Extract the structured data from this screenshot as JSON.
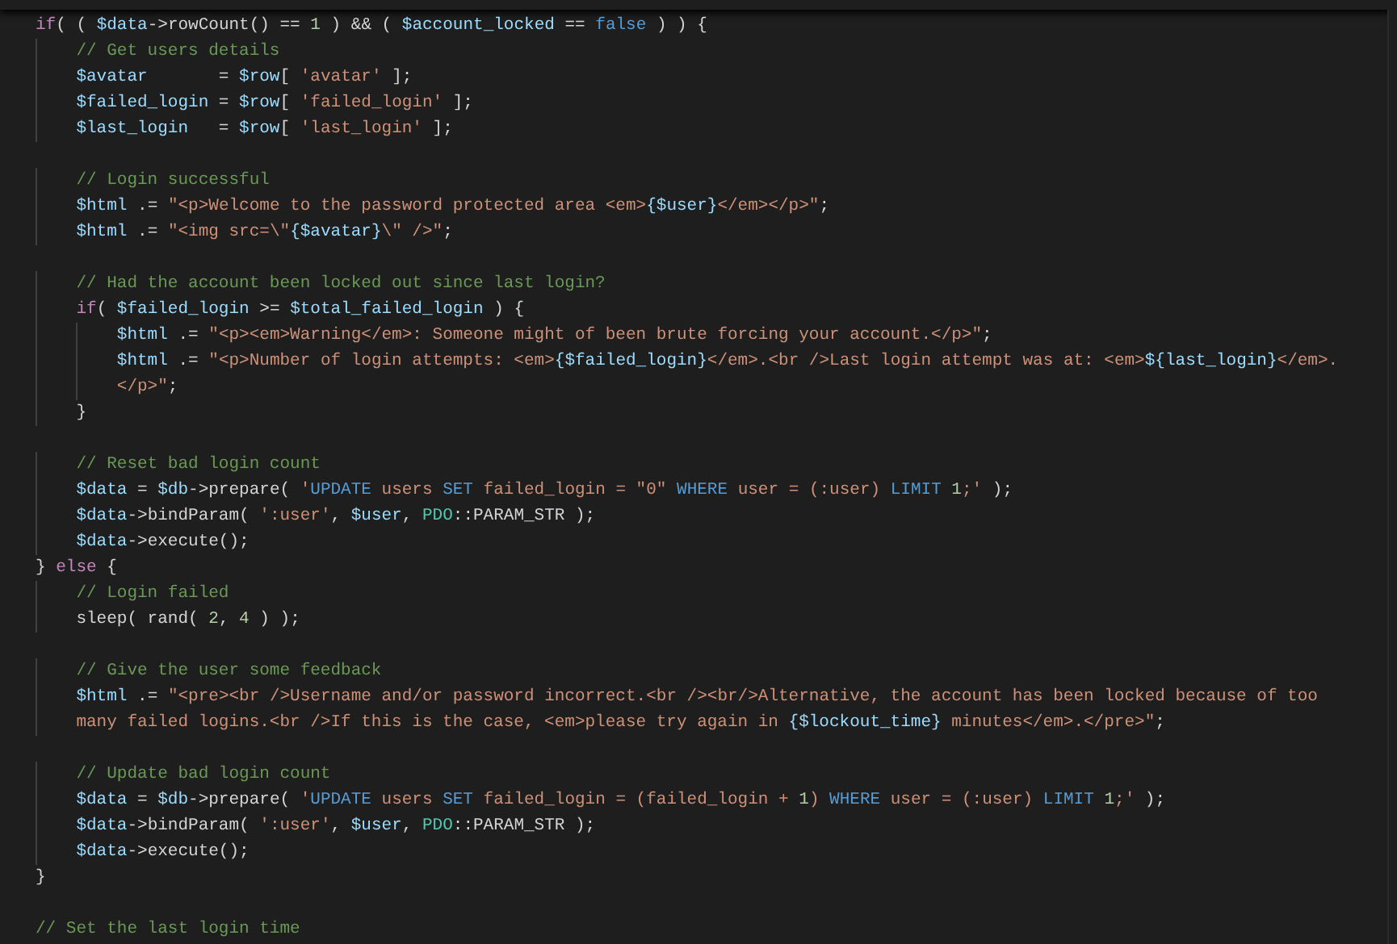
{
  "editor": {
    "lines": [
      {
        "kind": "code",
        "tokens": [
          {
            "kind": "keyword",
            "text": "if"
          },
          {
            "kind": "plain",
            "text": "( ( "
          },
          {
            "kind": "variable",
            "text": "$data"
          },
          {
            "kind": "plain",
            "text": "->rowCount() == "
          },
          {
            "kind": "number",
            "text": "1"
          },
          {
            "kind": "plain",
            "text": " ) && ( "
          },
          {
            "kind": "variable",
            "text": "$account_locked"
          },
          {
            "kind": "plain",
            "text": " == "
          },
          {
            "kind": "constant",
            "text": "false"
          },
          {
            "kind": "plain",
            "text": " ) ) {"
          }
        ]
      },
      {
        "kind": "code",
        "tokens": [
          {
            "kind": "comment",
            "text": "    // Get users details"
          }
        ]
      },
      {
        "kind": "code",
        "tokens": [
          {
            "kind": "variable",
            "text": "    $avatar"
          },
          {
            "kind": "plain",
            "text": "       = "
          },
          {
            "kind": "variable",
            "text": "$row"
          },
          {
            "kind": "plain",
            "text": "[ "
          },
          {
            "kind": "string",
            "text": "'avatar'"
          },
          {
            "kind": "plain",
            "text": " ];"
          }
        ]
      },
      {
        "kind": "code",
        "tokens": [
          {
            "kind": "variable",
            "text": "    $failed_login"
          },
          {
            "kind": "plain",
            "text": " = "
          },
          {
            "kind": "variable",
            "text": "$row"
          },
          {
            "kind": "plain",
            "text": "[ "
          },
          {
            "kind": "string",
            "text": "'failed_login'"
          },
          {
            "kind": "plain",
            "text": " ];"
          }
        ]
      },
      {
        "kind": "code",
        "tokens": [
          {
            "kind": "variable",
            "text": "    $last_login"
          },
          {
            "kind": "plain",
            "text": "   = "
          },
          {
            "kind": "variable",
            "text": "$row"
          },
          {
            "kind": "plain",
            "text": "[ "
          },
          {
            "kind": "string",
            "text": "'last_login'"
          },
          {
            "kind": "plain",
            "text": " ];"
          }
        ]
      },
      {
        "kind": "blank"
      },
      {
        "kind": "code",
        "tokens": [
          {
            "kind": "comment",
            "text": "    // Login successful"
          }
        ]
      },
      {
        "kind": "code",
        "tokens": [
          {
            "kind": "variable",
            "text": "    $html"
          },
          {
            "kind": "plain",
            "text": " .= "
          },
          {
            "kind": "string",
            "text": "\"<p>Welcome to the password protected area <em>"
          },
          {
            "kind": "variable",
            "text": "{$user}"
          },
          {
            "kind": "string",
            "text": "</em></p>\""
          },
          {
            "kind": "plain",
            "text": ";"
          }
        ]
      },
      {
        "kind": "code",
        "tokens": [
          {
            "kind": "variable",
            "text": "    $html"
          },
          {
            "kind": "plain",
            "text": " .= "
          },
          {
            "kind": "string",
            "text": "\"<img src=\\\""
          },
          {
            "kind": "variable",
            "text": "{$avatar}"
          },
          {
            "kind": "string",
            "text": "\\\" />\""
          },
          {
            "kind": "plain",
            "text": ";"
          }
        ]
      },
      {
        "kind": "blank"
      },
      {
        "kind": "code",
        "tokens": [
          {
            "kind": "comment",
            "text": "    // Had the account been locked out since last login?"
          }
        ]
      },
      {
        "kind": "code",
        "tokens": [
          {
            "kind": "keyword",
            "text": "    if"
          },
          {
            "kind": "plain",
            "text": "( "
          },
          {
            "kind": "variable",
            "text": "$failed_login"
          },
          {
            "kind": "plain",
            "text": " >= "
          },
          {
            "kind": "variable",
            "text": "$total_failed_login"
          },
          {
            "kind": "plain",
            "text": " ) {"
          }
        ]
      },
      {
        "kind": "code",
        "tokens": [
          {
            "kind": "variable",
            "text": "        $html"
          },
          {
            "kind": "plain",
            "text": " .= "
          },
          {
            "kind": "string",
            "text": "\"<p><em>Warning</em>: Someone might of been brute forcing your account.</p>\""
          },
          {
            "kind": "plain",
            "text": ";"
          }
        ]
      },
      {
        "kind": "code",
        "tokens": [
          {
            "kind": "variable",
            "text": "        $html"
          },
          {
            "kind": "plain",
            "text": " .= "
          },
          {
            "kind": "string",
            "text": "\"<p>Number of login attempts: <em>"
          },
          {
            "kind": "variable",
            "text": "{$failed_login}"
          },
          {
            "kind": "string",
            "text": "</em>.<br />Last login attempt was at: <em>"
          },
          {
            "kind": "variable",
            "text": "${last_login}"
          },
          {
            "kind": "string",
            "text": "</em>."
          }
        ]
      },
      {
        "kind": "code",
        "tokens": [
          {
            "kind": "string",
            "text": "        </p>\""
          },
          {
            "kind": "plain",
            "text": ";"
          }
        ]
      },
      {
        "kind": "code",
        "tokens": [
          {
            "kind": "plain",
            "text": "    }"
          }
        ]
      },
      {
        "kind": "blank"
      },
      {
        "kind": "code",
        "tokens": [
          {
            "kind": "comment",
            "text": "    // Reset bad login count"
          }
        ]
      },
      {
        "kind": "code",
        "tokens": [
          {
            "kind": "variable",
            "text": "    $data"
          },
          {
            "kind": "plain",
            "text": " = "
          },
          {
            "kind": "variable",
            "text": "$db"
          },
          {
            "kind": "plain",
            "text": "->prepare( "
          },
          {
            "kind": "string",
            "text": "'"
          },
          {
            "kind": "constant",
            "text": "UPDATE"
          },
          {
            "kind": "string",
            "text": " users "
          },
          {
            "kind": "constant",
            "text": "SET"
          },
          {
            "kind": "string",
            "text": " failed_login = \"0\" "
          },
          {
            "kind": "constant",
            "text": "WHERE"
          },
          {
            "kind": "string",
            "text": " user = (:user) "
          },
          {
            "kind": "constant",
            "text": "LIMIT "
          },
          {
            "kind": "number",
            "text": "1"
          },
          {
            "kind": "string",
            "text": ";'"
          },
          {
            "kind": "plain",
            "text": " );"
          }
        ]
      },
      {
        "kind": "code",
        "tokens": [
          {
            "kind": "variable",
            "text": "    $data"
          },
          {
            "kind": "plain",
            "text": "->bindParam( "
          },
          {
            "kind": "string",
            "text": "':user'"
          },
          {
            "kind": "plain",
            "text": ", "
          },
          {
            "kind": "variable",
            "text": "$user"
          },
          {
            "kind": "plain",
            "text": ", "
          },
          {
            "kind": "type",
            "text": "PDO"
          },
          {
            "kind": "plain",
            "text": "::PARAM_STR );"
          }
        ]
      },
      {
        "kind": "code",
        "tokens": [
          {
            "kind": "variable",
            "text": "    $data"
          },
          {
            "kind": "plain",
            "text": "->execute();"
          }
        ]
      },
      {
        "kind": "code",
        "tokens": [
          {
            "kind": "plain",
            "text": "} "
          },
          {
            "kind": "keyword",
            "text": "else"
          },
          {
            "kind": "plain",
            "text": " {"
          }
        ]
      },
      {
        "kind": "code",
        "tokens": [
          {
            "kind": "comment",
            "text": "    // Login failed"
          }
        ]
      },
      {
        "kind": "code",
        "tokens": [
          {
            "kind": "plain",
            "text": "    sleep( rand( "
          },
          {
            "kind": "number",
            "text": "2"
          },
          {
            "kind": "plain",
            "text": ", "
          },
          {
            "kind": "number",
            "text": "4"
          },
          {
            "kind": "plain",
            "text": " ) );"
          }
        ]
      },
      {
        "kind": "blank"
      },
      {
        "kind": "code",
        "tokens": [
          {
            "kind": "comment",
            "text": "    // Give the user some feedback"
          }
        ]
      },
      {
        "kind": "code",
        "tokens": [
          {
            "kind": "variable",
            "text": "    $html"
          },
          {
            "kind": "plain",
            "text": " .= "
          },
          {
            "kind": "string",
            "text": "\"<pre><br />Username and/or password incorrect.<br /><br/>Alternative, the account has been locked because of too"
          }
        ]
      },
      {
        "kind": "code",
        "tokens": [
          {
            "kind": "string",
            "text": "    many failed logins.<br />If this is the case, <em>please try again in "
          },
          {
            "kind": "variable",
            "text": "{$lockout_time}"
          },
          {
            "kind": "string",
            "text": " minutes</em>.</pre>\""
          },
          {
            "kind": "plain",
            "text": ";"
          }
        ]
      },
      {
        "kind": "blank"
      },
      {
        "kind": "code",
        "tokens": [
          {
            "kind": "comment",
            "text": "    // Update bad login count"
          }
        ]
      },
      {
        "kind": "code",
        "tokens": [
          {
            "kind": "variable",
            "text": "    $data"
          },
          {
            "kind": "plain",
            "text": " = "
          },
          {
            "kind": "variable",
            "text": "$db"
          },
          {
            "kind": "plain",
            "text": "->prepare( "
          },
          {
            "kind": "string",
            "text": "'"
          },
          {
            "kind": "constant",
            "text": "UPDATE"
          },
          {
            "kind": "string",
            "text": " users "
          },
          {
            "kind": "constant",
            "text": "SET"
          },
          {
            "kind": "string",
            "text": " failed_login = (failed_login + "
          },
          {
            "kind": "number",
            "text": "1"
          },
          {
            "kind": "string",
            "text": ") "
          },
          {
            "kind": "constant",
            "text": "WHERE"
          },
          {
            "kind": "string",
            "text": " user = (:user) "
          },
          {
            "kind": "constant",
            "text": "LIMIT "
          },
          {
            "kind": "number",
            "text": "1"
          },
          {
            "kind": "string",
            "text": ";'"
          },
          {
            "kind": "plain",
            "text": " );"
          }
        ]
      },
      {
        "kind": "code",
        "tokens": [
          {
            "kind": "variable",
            "text": "    $data"
          },
          {
            "kind": "plain",
            "text": "->bindParam( "
          },
          {
            "kind": "string",
            "text": "':user'"
          },
          {
            "kind": "plain",
            "text": ", "
          },
          {
            "kind": "variable",
            "text": "$user"
          },
          {
            "kind": "plain",
            "text": ", "
          },
          {
            "kind": "type",
            "text": "PDO"
          },
          {
            "kind": "plain",
            "text": "::PARAM_STR );"
          }
        ]
      },
      {
        "kind": "code",
        "tokens": [
          {
            "kind": "variable",
            "text": "    $data"
          },
          {
            "kind": "plain",
            "text": "->execute();"
          }
        ]
      },
      {
        "kind": "code",
        "tokens": [
          {
            "kind": "plain",
            "text": "}"
          }
        ]
      },
      {
        "kind": "blank"
      },
      {
        "kind": "code",
        "tokens": [
          {
            "kind": "comment",
            "text": "// Set the last login time"
          }
        ]
      }
    ]
  }
}
